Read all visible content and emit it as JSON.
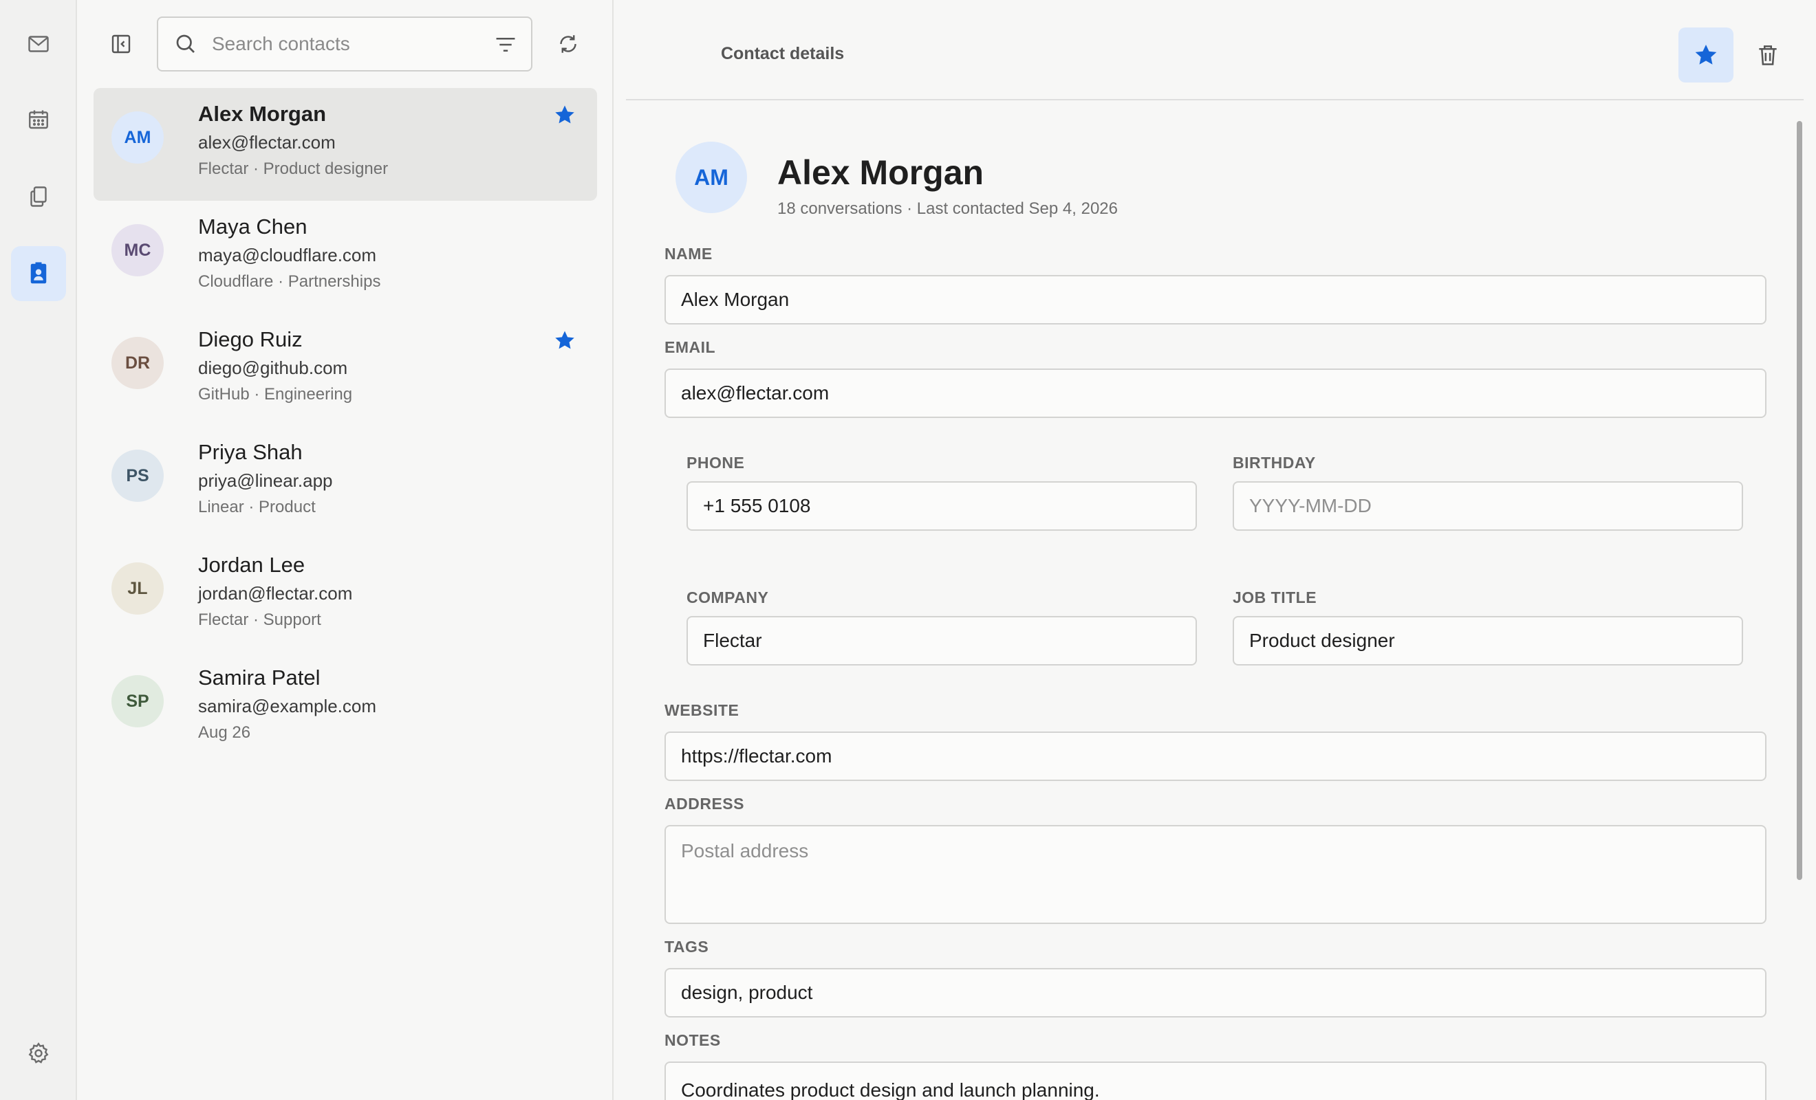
{
  "search": {
    "placeholder": "Search contacts"
  },
  "contacts": [
    {
      "initials": "AM",
      "name": "Alex Morgan",
      "email": "alex@flectar.com",
      "meta": "Flectar · Product designer",
      "starred": true,
      "avatar_bg": "#dde9fb",
      "avatar_fg": "#1565d8"
    },
    {
      "initials": "MC",
      "name": "Maya Chen",
      "email": "maya@cloudflare.com",
      "meta": "Cloudflare · Partnerships",
      "starred": false,
      "avatar_bg": "#e6e1ee",
      "avatar_fg": "#5a4a72"
    },
    {
      "initials": "DR",
      "name": "Diego Ruiz",
      "email": "diego@github.com",
      "meta": "GitHub · Engineering",
      "starred": true,
      "avatar_bg": "#ebe3de",
      "avatar_fg": "#6a4e40"
    },
    {
      "initials": "PS",
      "name": "Priya Shah",
      "email": "priya@linear.app",
      "meta": "Linear · Product",
      "starred": false,
      "avatar_bg": "#dfe7ee",
      "avatar_fg": "#3e5566"
    },
    {
      "initials": "JL",
      "name": "Jordan Lee",
      "email": "jordan@flectar.com",
      "meta": "Flectar · Support",
      "starred": false,
      "avatar_bg": "#ece8dc",
      "avatar_fg": "#5e5640"
    },
    {
      "initials": "SP",
      "name": "Samira Patel",
      "email": "samira@example.com",
      "meta": "Aug 26",
      "starred": false,
      "avatar_bg": "#e1ebe0",
      "avatar_fg": "#3f5a3c"
    }
  ],
  "detail": {
    "header_title": "Contact details",
    "avatar_initials": "AM",
    "name": "Alex Morgan",
    "subtitle": "18 conversations · Last contacted Sep 4, 2026",
    "fields": {
      "name": {
        "label": "NAME",
        "value": "Alex Morgan"
      },
      "email": {
        "label": "EMAIL",
        "value": "alex@flectar.com"
      },
      "phone": {
        "label": "PHONE",
        "value": "+1 555 0108"
      },
      "birthday": {
        "label": "BIRTHDAY",
        "value": "",
        "placeholder": "YYYY-MM-DD"
      },
      "company": {
        "label": "COMPANY",
        "value": "Flectar"
      },
      "job_title": {
        "label": "JOB TITLE",
        "value": "Product designer"
      },
      "website": {
        "label": "WEBSITE",
        "value": "https://flectar.com"
      },
      "address": {
        "label": "ADDRESS",
        "value": "",
        "placeholder": "Postal address"
      },
      "tags": {
        "label": "TAGS",
        "value": "design, product"
      },
      "notes": {
        "label": "NOTES",
        "value": "Coordinates product design and launch planning."
      }
    }
  },
  "colors": {
    "accent": "#1565d8",
    "accent_soft": "#dde9fb"
  }
}
